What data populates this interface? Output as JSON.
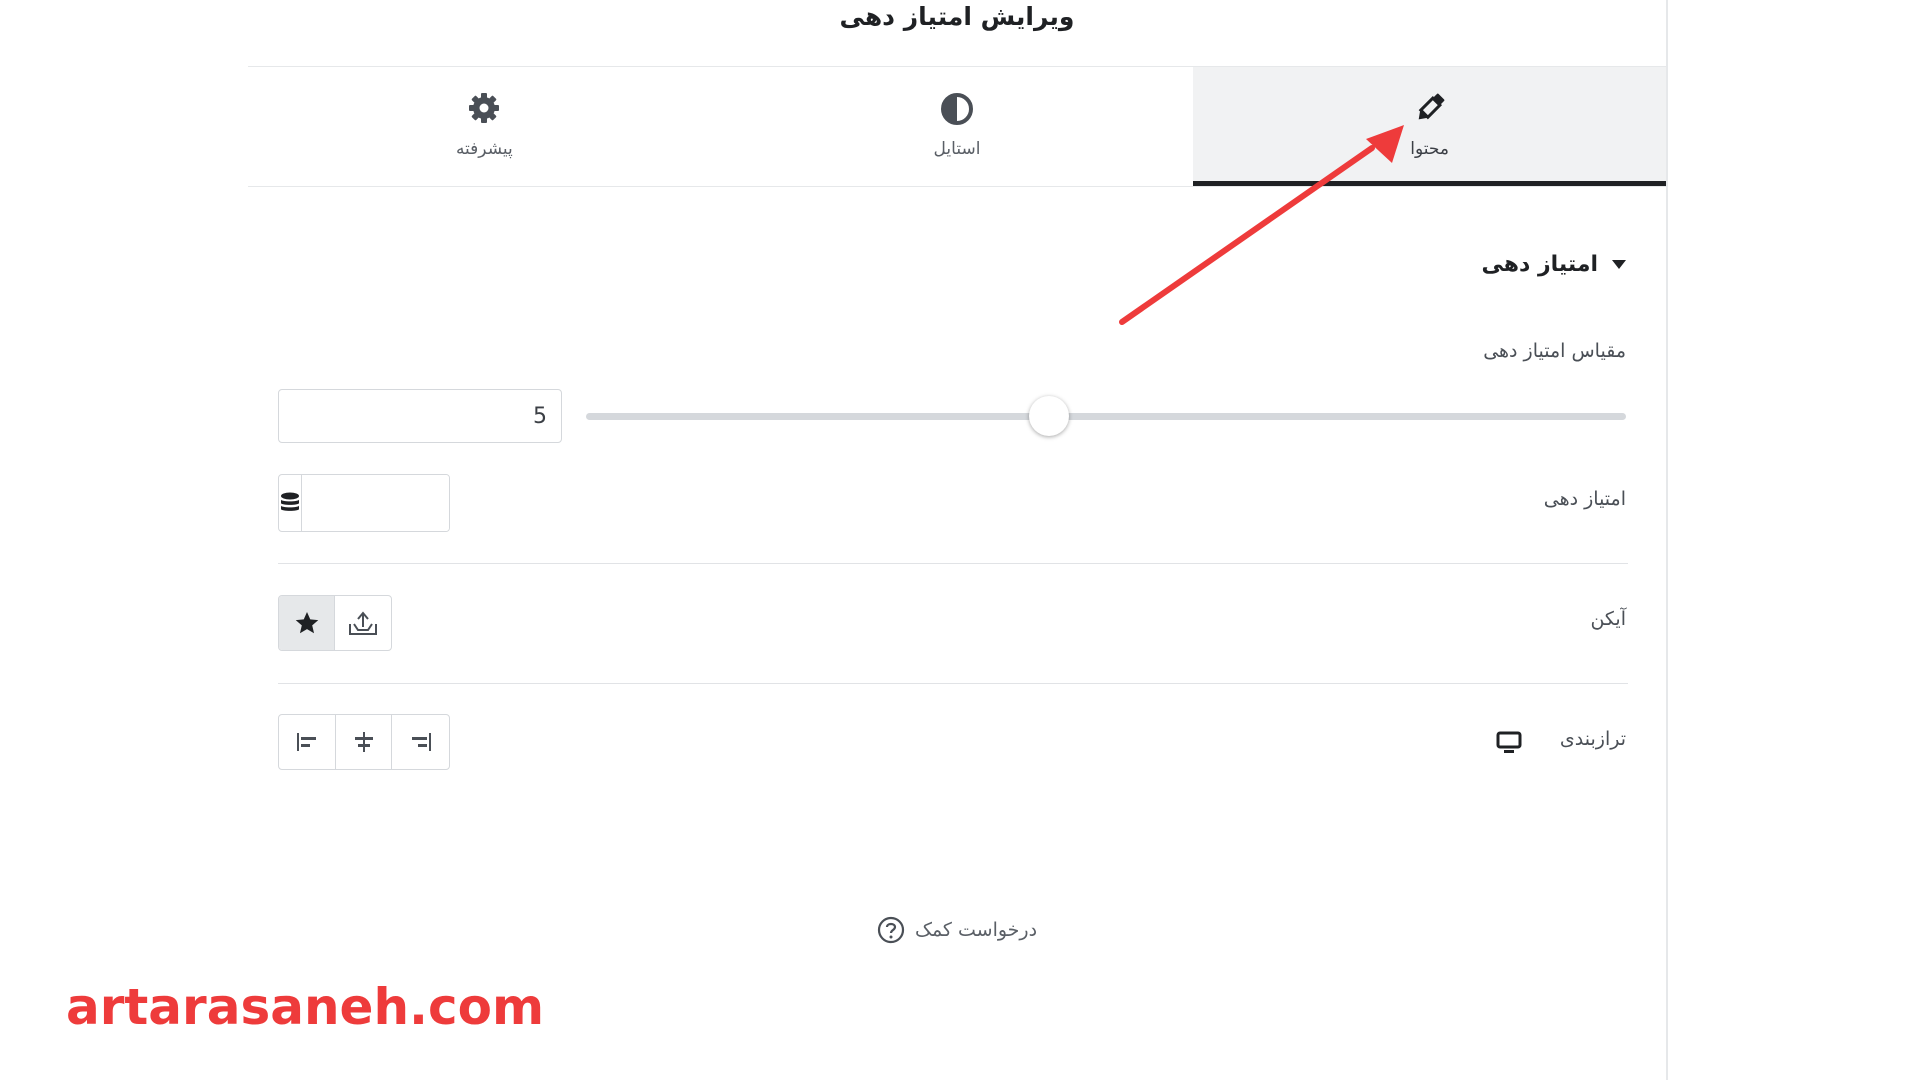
{
  "panel": {
    "title": "ویرایش امتیاز دهی"
  },
  "tabs": [
    {
      "label": "پیشرفته",
      "icon": "gear-icon",
      "active": false
    },
    {
      "label": "استایل",
      "icon": "half-circle-icon",
      "active": false
    },
    {
      "label": "محتوا",
      "icon": "pencil-icon",
      "active": true
    }
  ],
  "section": {
    "title": "امتیاز دهی"
  },
  "controls": {
    "scale_label": "مقیاس امتیاز دهی",
    "scale_value": "5",
    "scale_fraction": 0.445,
    "rating_label": "امتیاز دهی",
    "icon_label": "آیکن",
    "alignment_label": "ترازبندی"
  },
  "help": {
    "label": "درخواست کمک"
  },
  "watermark": {
    "text": "artarasaneh.com"
  },
  "colors": {
    "accent_dark": "#1f2124",
    "arrow": "#ee3b3b",
    "active_tab_bg": "#f1f2f3"
  }
}
